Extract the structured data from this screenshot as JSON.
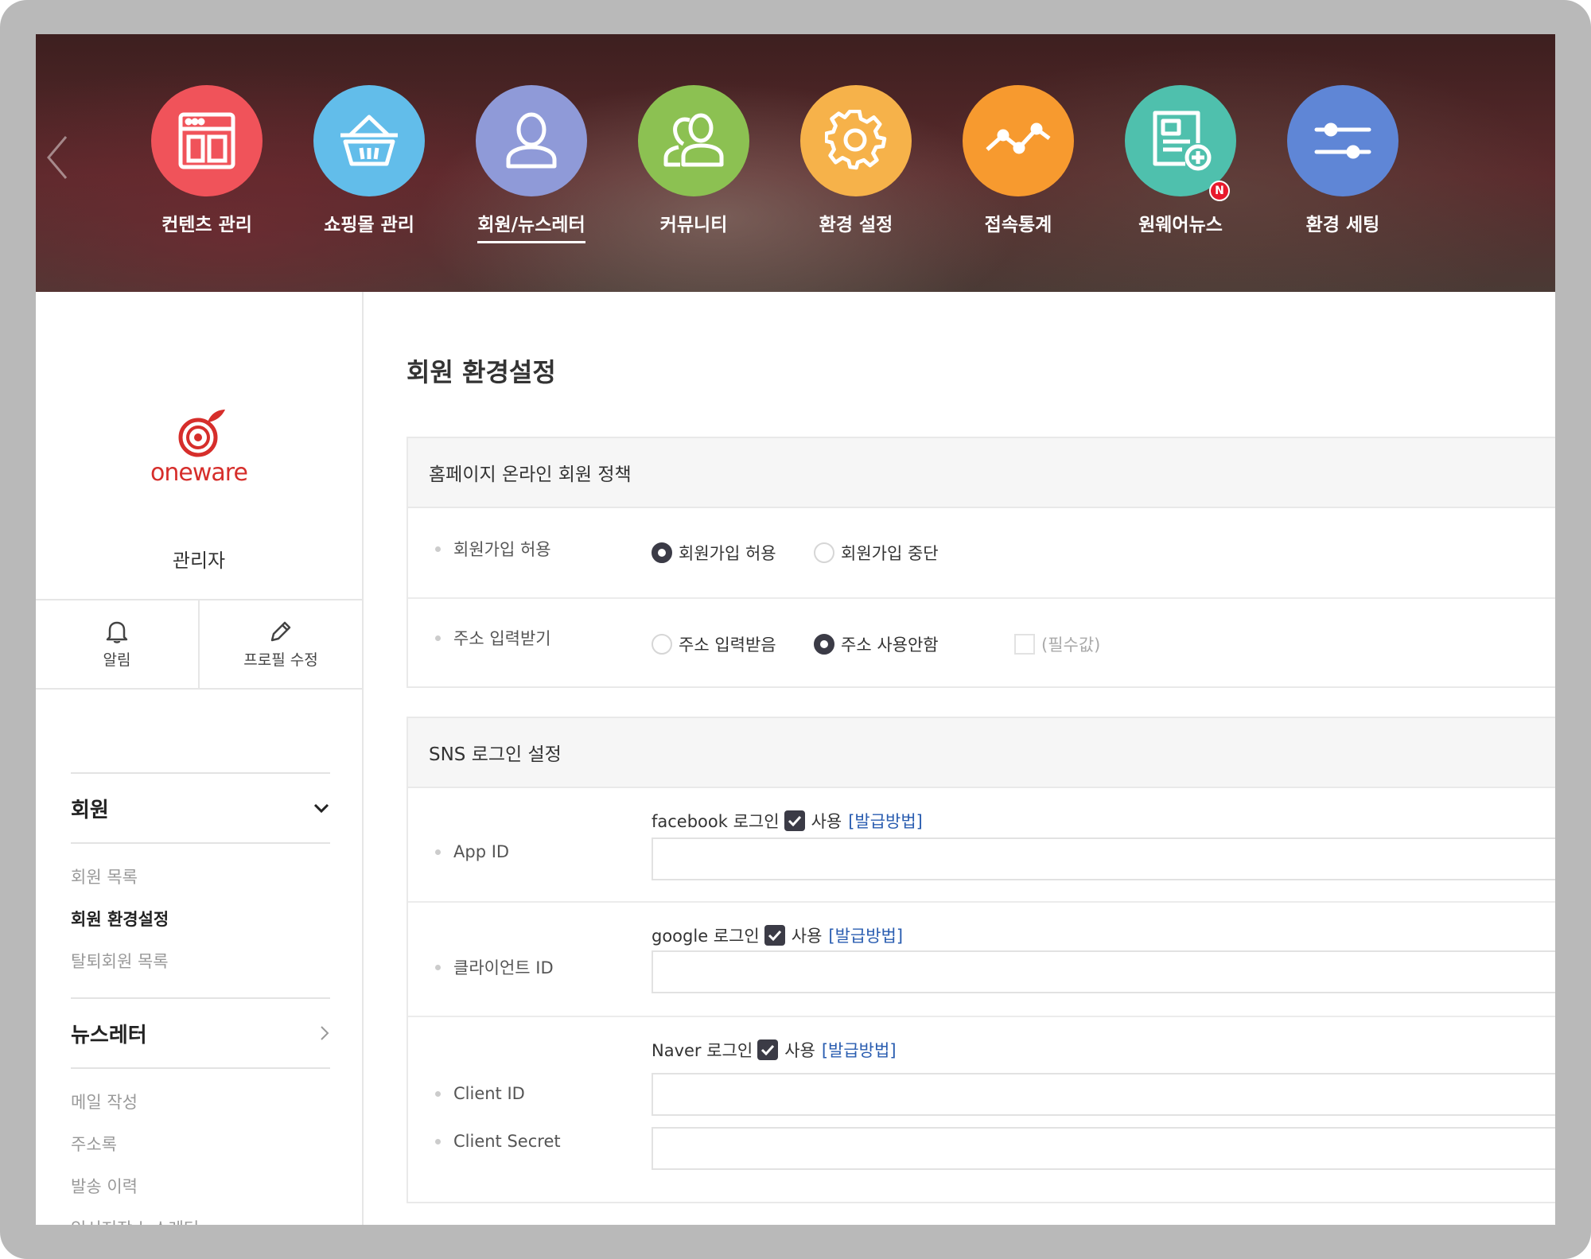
{
  "topnav": {
    "items": [
      {
        "label": "컨텐츠 관리",
        "color": "#f0535a",
        "icon": "content-window-icon"
      },
      {
        "label": "쇼핑몰 관리",
        "color": "#62bdea",
        "icon": "basket-icon"
      },
      {
        "label": "회원/뉴스레터",
        "color": "#8f9ad8",
        "icon": "user-icon",
        "active": true
      },
      {
        "label": "커뮤니티",
        "color": "#8cc152",
        "icon": "users-icon"
      },
      {
        "label": "환경 설정",
        "color": "#f6b24a",
        "icon": "gear-icon"
      },
      {
        "label": "접속통계",
        "color": "#f79a2f",
        "icon": "trend-line-icon"
      },
      {
        "label": "원웨어뉴스",
        "color": "#4fc0ad",
        "icon": "news-add-icon",
        "badge": "N"
      },
      {
        "label": "환경 세팅",
        "color": "#5f86d6",
        "icon": "sliders-icon"
      }
    ]
  },
  "sidebar": {
    "logo_text": "oneware",
    "role": "관리자",
    "quick": {
      "alarm": "알림",
      "profile_edit": "프로필 수정"
    },
    "sections": [
      {
        "title": "회원",
        "expanded": true,
        "items": [
          {
            "label": "회원 목록",
            "active": false
          },
          {
            "label": "회원 환경설정",
            "active": true
          },
          {
            "label": "탈퇴회원 목록",
            "active": false
          }
        ]
      },
      {
        "title": "뉴스레터",
        "expanded": false,
        "items": [
          {
            "label": "메일 작성"
          },
          {
            "label": "주소록"
          },
          {
            "label": "발송 이력"
          },
          {
            "label": "임시저장 뉴스레터"
          }
        ]
      }
    ]
  },
  "main": {
    "title": "회원 환경설정",
    "policy": {
      "heading": "홈페이지 온라인 회원 정책",
      "join_label": "회원가입 허용",
      "join_options": [
        "회원가입 허용",
        "회원가입 중단"
      ],
      "join_selected": 0,
      "address_label": "주소 입력받기",
      "address_options": [
        "주소 입력받음",
        "주소 사용안함"
      ],
      "address_selected": 1,
      "required_label": "(필수값)"
    },
    "sns": {
      "heading": "SNS 로그인 설정",
      "use_label": "사용",
      "how_label": "[발급방법]",
      "facebook": {
        "title": "facebook 로그인",
        "field_label": "App ID",
        "value": ""
      },
      "google": {
        "title": "google 로그인",
        "field_label": "클라이언트 ID",
        "value": ""
      },
      "naver": {
        "title": "Naver 로그인",
        "id_label": "Client ID",
        "secret_label": "Client Secret",
        "id_value": "",
        "secret_value": ""
      }
    }
  }
}
